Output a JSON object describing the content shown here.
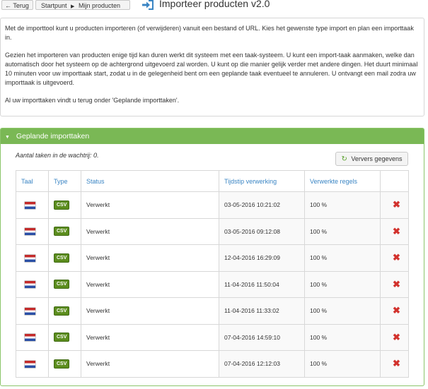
{
  "topbar": {
    "back_label": "Terug",
    "back_arrow": "arrow-left-icon",
    "breadcrumb_home": "Startpunt",
    "breadcrumb_current": "Mijn producten",
    "title": "Importeer producten v2.0",
    "title_icon": "sign-in-icon",
    "title_icon_color": "#3a85c4"
  },
  "intro": {
    "p1": "Met de importtool kunt u producten importeren (of verwijderen) vanuit een bestand of URL. Kies het gewenste type import en plan een importtaak in.",
    "p2": "Gezien het importeren van producten enige tijd kan duren werkt dit systeem met een taak-systeem. U kunt een import-taak aanmaken, welke dan automatisch door het systeem op de achtergrond uitgevoerd zal worden. U kunt op die manier gelijk verder met andere dingen. Het duurt minimaal 10 minuten voor uw importtaak start, zodat u in de gelegenheid bent om een geplande taak eventueel te annuleren. U ontvangt een mail zodra uw importtaak is uitgevoerd.",
    "p3": "Al uw importtaken vindt u terug onder 'Geplande importtaken'."
  },
  "panel": {
    "title": "Geplande importtaken",
    "header_color": "#7ab855",
    "queue_count": "Aantal taken in de wachtrij: 0.",
    "refresh_label": "Ververs gegevens",
    "columns": [
      "Taal",
      "Type",
      "Status",
      "Tijdstip verwerking",
      "Verwerkte regels",
      ""
    ],
    "rows": [
      {
        "lang": "nl-flag-icon",
        "type": "CSV",
        "status": "Verwerkt",
        "time": "03-05-2016 10:21:02",
        "processed": "100 %"
      },
      {
        "lang": "nl-flag-icon",
        "type": "CSV",
        "status": "Verwerkt",
        "time": "03-05-2016 09:12:08",
        "processed": "100 %"
      },
      {
        "lang": "nl-flag-icon",
        "type": "CSV",
        "status": "Verwerkt",
        "time": "12-04-2016 16:29:09",
        "processed": "100 %"
      },
      {
        "lang": "nl-flag-icon",
        "type": "CSV",
        "status": "Verwerkt",
        "time": "11-04-2016 11:50:04",
        "processed": "100 %"
      },
      {
        "lang": "nl-flag-icon",
        "type": "CSV",
        "status": "Verwerkt",
        "time": "11-04-2016 11:33:02",
        "processed": "100 %"
      },
      {
        "lang": "nl-flag-icon",
        "type": "CSV",
        "status": "Verwerkt",
        "time": "07-04-2016 14:59:10",
        "processed": "100 %"
      },
      {
        "lang": "nl-flag-icon",
        "type": "CSV",
        "status": "Verwerkt",
        "time": "07-04-2016 12:12:03",
        "processed": "100 %"
      }
    ],
    "delete_icon": "delete-x-icon",
    "delete_color": "#d2322d"
  }
}
